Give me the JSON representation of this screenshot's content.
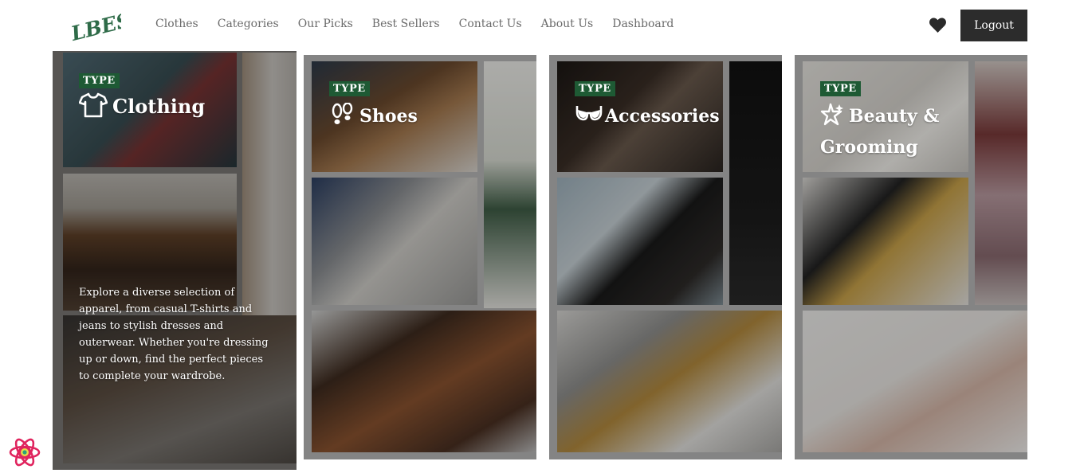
{
  "header": {
    "logo_text": "LBESS",
    "logo_icon": "brand-logo",
    "nav": [
      "Clothes",
      "Categories",
      "Our Picks",
      "Best Sellers",
      "Contact Us",
      "About Us",
      "Dashboard"
    ],
    "favorites_icon": "heart-icon",
    "logout_label": "Logout"
  },
  "cards": [
    {
      "badge": "TYPE",
      "title": "Clothing",
      "icon": "tshirt-icon",
      "description": "Explore a diverse selection of apparel, from casual T-shirts and jeans to stylish dresses and outerwear. Whether you're dressing up or down, find the perfect pieces to complete your wardrobe."
    },
    {
      "badge": "TYPE",
      "title": "Shoes",
      "icon": "footprints-icon"
    },
    {
      "badge": "TYPE",
      "title": "Accessories",
      "icon": "sunglasses-icon"
    },
    {
      "badge": "TYPE",
      "title": "Beauty & Grooming",
      "icon": "sparkle-icon"
    }
  ],
  "colors": {
    "badge_bg": "#1e5a34",
    "logo_green": "#2e6b48",
    "logout_bg": "#2c2c2c",
    "nav_text": "#6b6b6b"
  },
  "dev_badge_icon": "react-devtools-icon"
}
